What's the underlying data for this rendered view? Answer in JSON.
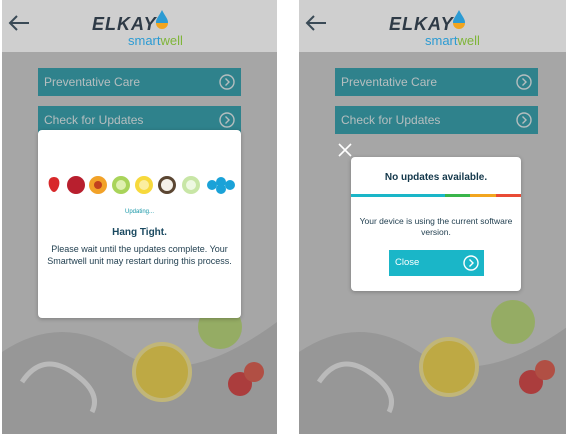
{
  "brand": {
    "name": "ELKAY",
    "sub_prefix": "smart",
    "sub_suffix": "well"
  },
  "menu": {
    "preventative_care": "Preventative Care",
    "check_updates": "Check for Updates"
  },
  "updating_dialog": {
    "status": "Updating...",
    "title": "Hang Tight.",
    "body": "Please wait until the updates complete. Your Smartwell unit may restart during this process."
  },
  "no_updates_dialog": {
    "title": "No updates available.",
    "body": "Your device is using the current software version.",
    "close_label": "Close"
  },
  "colors": {
    "teal": "#1998a8",
    "button": "#1ab6c8",
    "bar": [
      "#1ab6c8",
      "#39b54a",
      "#f2a51f",
      "#e94b35"
    ]
  },
  "icons": [
    "back-arrow-icon",
    "chevron-right-icon",
    "close-icon",
    "water-drop-icon"
  ]
}
